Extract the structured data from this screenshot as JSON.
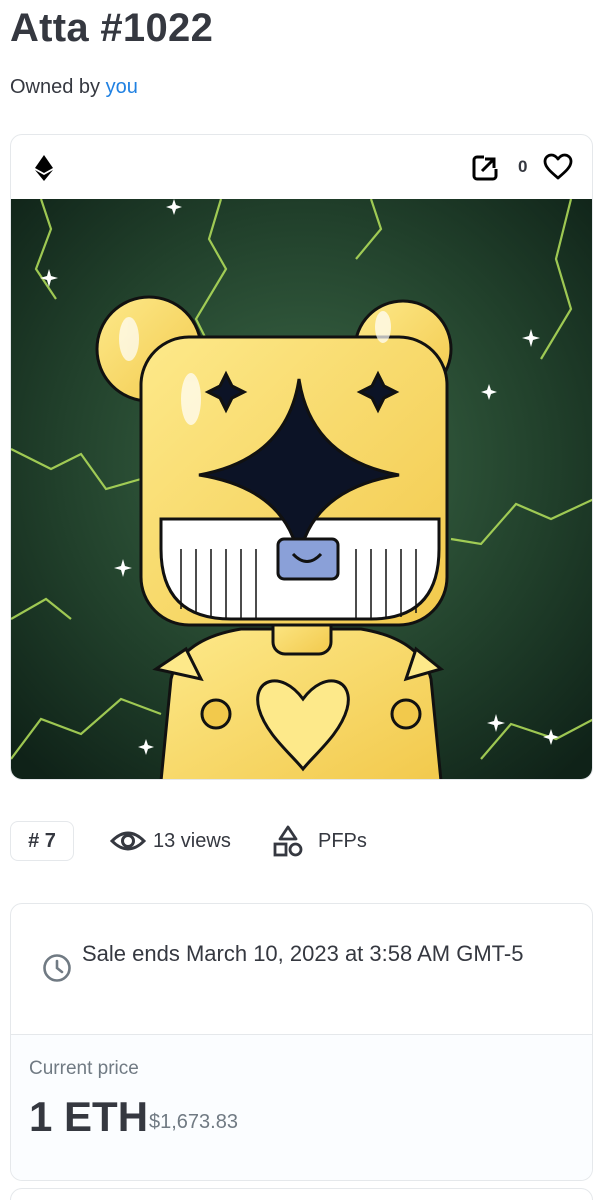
{
  "asset": {
    "title": "Atta #1022",
    "owned_prefix": "Owned by ",
    "owner": "you"
  },
  "card": {
    "chain_icon": "ethereum-icon",
    "external_link_icon": "external-link-icon",
    "favorites_count": "0",
    "favorite_icon": "heart-icon",
    "artwork_icon": "yellow-robot-bear-on-green-lightning"
  },
  "stats": {
    "rank": "# 7",
    "views": "13 views",
    "category": "PFPs",
    "views_icon": "eye-icon",
    "category_icon": "shapes-icon"
  },
  "sale": {
    "clock_icon": "clock-icon",
    "ends_text": "Sale ends March 10, 2023 at 3:58 AM GMT-5",
    "price_label": "Current price",
    "price": "1 ETH",
    "fiat": "$1,673.83"
  },
  "colors": {
    "link": "#2081e2",
    "text": "#353840",
    "muted": "#707a83",
    "border": "#e5e8eb"
  }
}
